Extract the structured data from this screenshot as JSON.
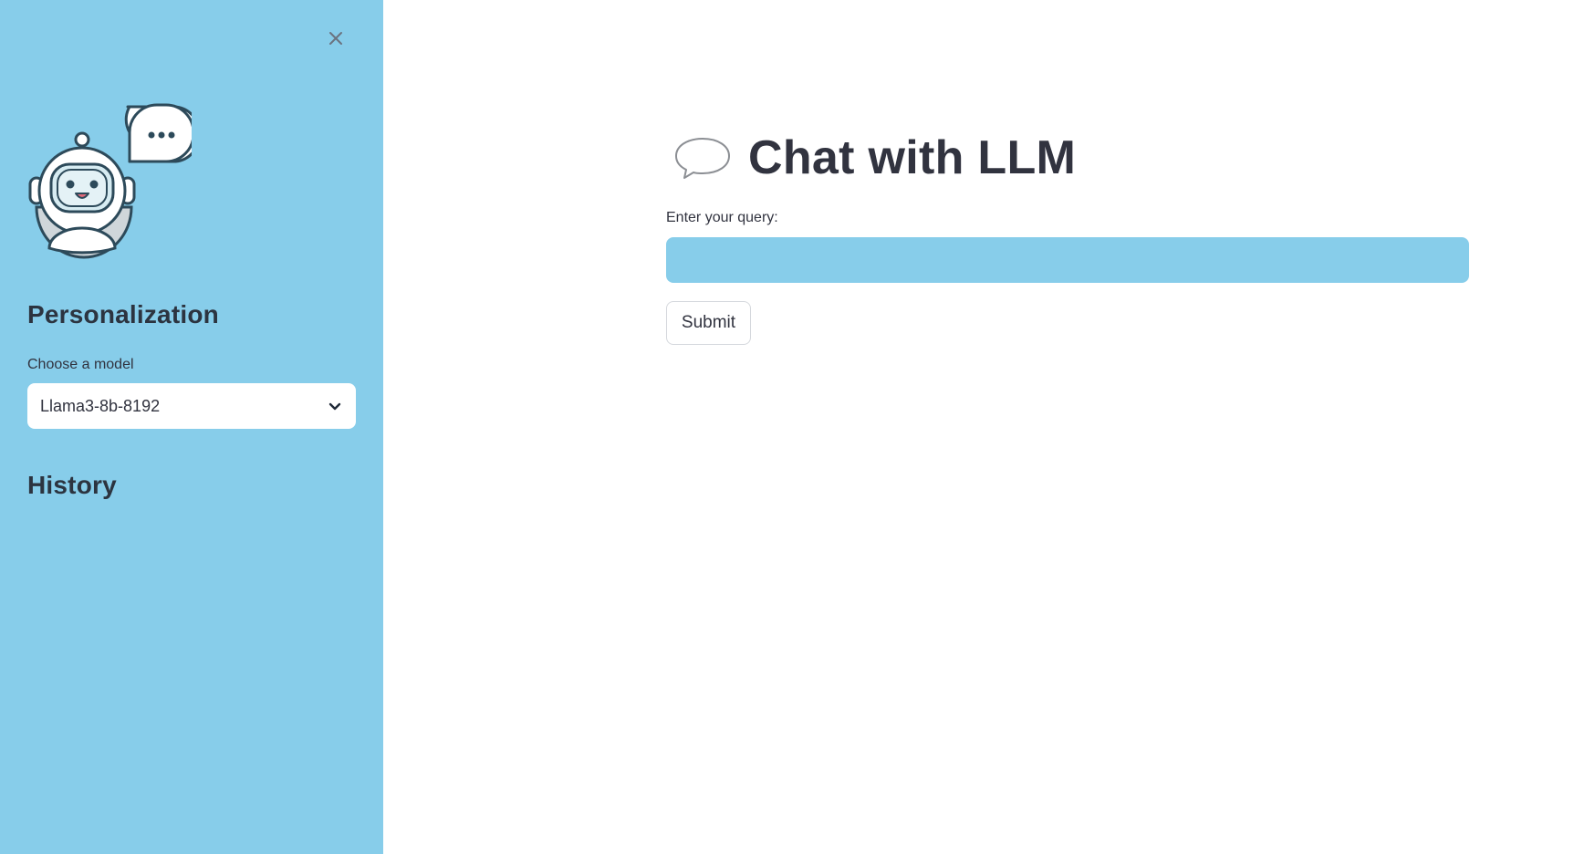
{
  "sidebar": {
    "close_icon": "close-icon",
    "logo_icon": "robot-chat-icon",
    "personalization_heading": "Personalization",
    "model_label": "Choose a model",
    "model_selected": "Llama3-8b-8192",
    "dropdown_icon": "chevron-down-icon",
    "history_heading": "History",
    "background_color": "#87cdea"
  },
  "main": {
    "title_icon": "speech-bubble-icon",
    "title": "Chat with LLM",
    "query_label": "Enter your query:",
    "query_value": "",
    "query_input_color": "#87cdea",
    "submit_label": "Submit"
  }
}
